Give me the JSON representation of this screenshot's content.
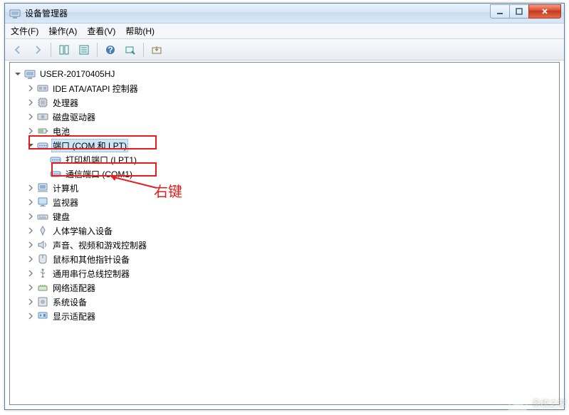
{
  "window": {
    "title": "设备管理器"
  },
  "menu": {
    "file": "文件(F)",
    "action": "操作(A)",
    "view": "查看(V)",
    "help": "帮助(H)"
  },
  "tree": {
    "root": "USER-20170405HJ",
    "items": [
      {
        "label": "IDE ATA/ATAPI 控制器",
        "icon": "ide"
      },
      {
        "label": "处理器",
        "icon": "cpu"
      },
      {
        "label": "磁盘驱动器",
        "icon": "disk"
      },
      {
        "label": "电池",
        "icon": "battery"
      },
      {
        "label": "端口 (COM 和 LPT)",
        "icon": "port",
        "expanded": true,
        "selected": true,
        "children": [
          {
            "label": "打印机端口 (LPT1)",
            "icon": "port"
          },
          {
            "label": "通信端口 (COM1)",
            "icon": "port"
          }
        ]
      },
      {
        "label": "计算机",
        "icon": "computer"
      },
      {
        "label": "监视器",
        "icon": "monitor"
      },
      {
        "label": "键盘",
        "icon": "keyboard"
      },
      {
        "label": "人体学输入设备",
        "icon": "hid"
      },
      {
        "label": "声音、视频和游戏控制器",
        "icon": "sound"
      },
      {
        "label": "鼠标和其他指针设备",
        "icon": "mouse"
      },
      {
        "label": "通用串行总线控制器",
        "icon": "usb"
      },
      {
        "label": "网络适配器",
        "icon": "network"
      },
      {
        "label": "系统设备",
        "icon": "system"
      },
      {
        "label": "显示适配器",
        "icon": "display"
      }
    ]
  },
  "annotation": {
    "text": "右键"
  },
  "watermark": {
    "text": "系统之家"
  }
}
